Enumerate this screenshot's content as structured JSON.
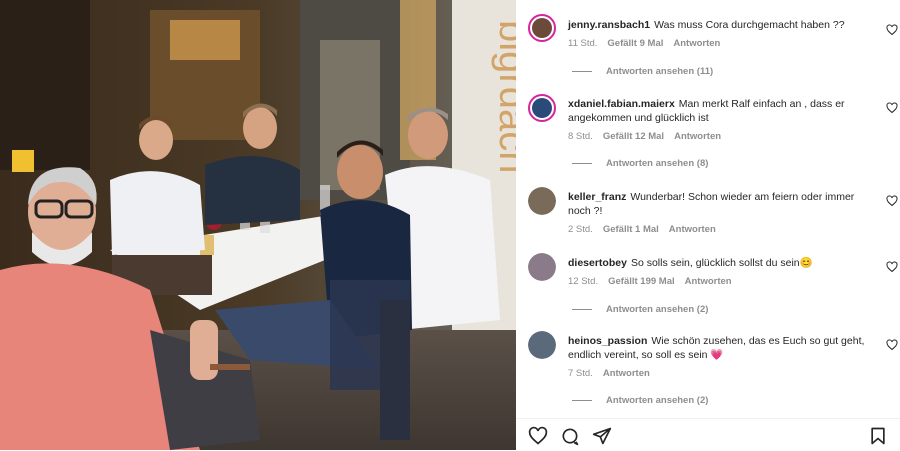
{
  "comments": [
    {
      "username": "jenny.ransbach1",
      "text": "Was muss Cora durchgemacht haben ??",
      "time": "11 Std.",
      "likes": "Gefällt 9 Mal",
      "reply": "Antworten",
      "view_replies": "Antworten ansehen (11)",
      "avatar_color": "#6b4a3a",
      "ring": true
    },
    {
      "username": "xdaniel.fabian.maierx",
      "text": "Man merkt Ralf einfach an , dass er angekommen und glücklich ist",
      "time": "8 Std.",
      "likes": "Gefällt 12 Mal",
      "reply": "Antworten",
      "view_replies": "Antworten ansehen (8)",
      "avatar_color": "#2a4a7a",
      "ring": true
    },
    {
      "username": "keller_franz",
      "text": "Wunderbar! Schon wieder am feiern oder immer noch ?!",
      "time": "2 Std.",
      "likes": "Gefällt 1 Mal",
      "reply": "Antworten",
      "avatar_color": "#7a6a5a",
      "ring": false
    },
    {
      "username": "diesertobey",
      "text": "So solls sein, glücklich sollst du sein😊",
      "time": "12 Std.",
      "likes": "Gefällt 199 Mal",
      "reply": "Antworten",
      "view_replies": "Antworten ansehen (2)",
      "avatar_color": "#8a7a8a",
      "ring": false
    },
    {
      "username": "heinos_passion",
      "text": "Wie schön zusehen, das es Euch so gut geht, endlich vereint, so soll es sein 💗",
      "time": "7 Std.",
      "likes": "",
      "reply": "Antworten",
      "view_replies": "Antworten ansehen (2)",
      "avatar_color": "#5a6a7a",
      "ring": false
    }
  ],
  "icons": {
    "like": "heart-icon",
    "comment": "comment-icon",
    "share": "share-icon",
    "save": "bookmark-icon"
  },
  "colors": {
    "text": "#262626",
    "muted": "#8e8e8e",
    "story_ring": "#d6249f"
  }
}
